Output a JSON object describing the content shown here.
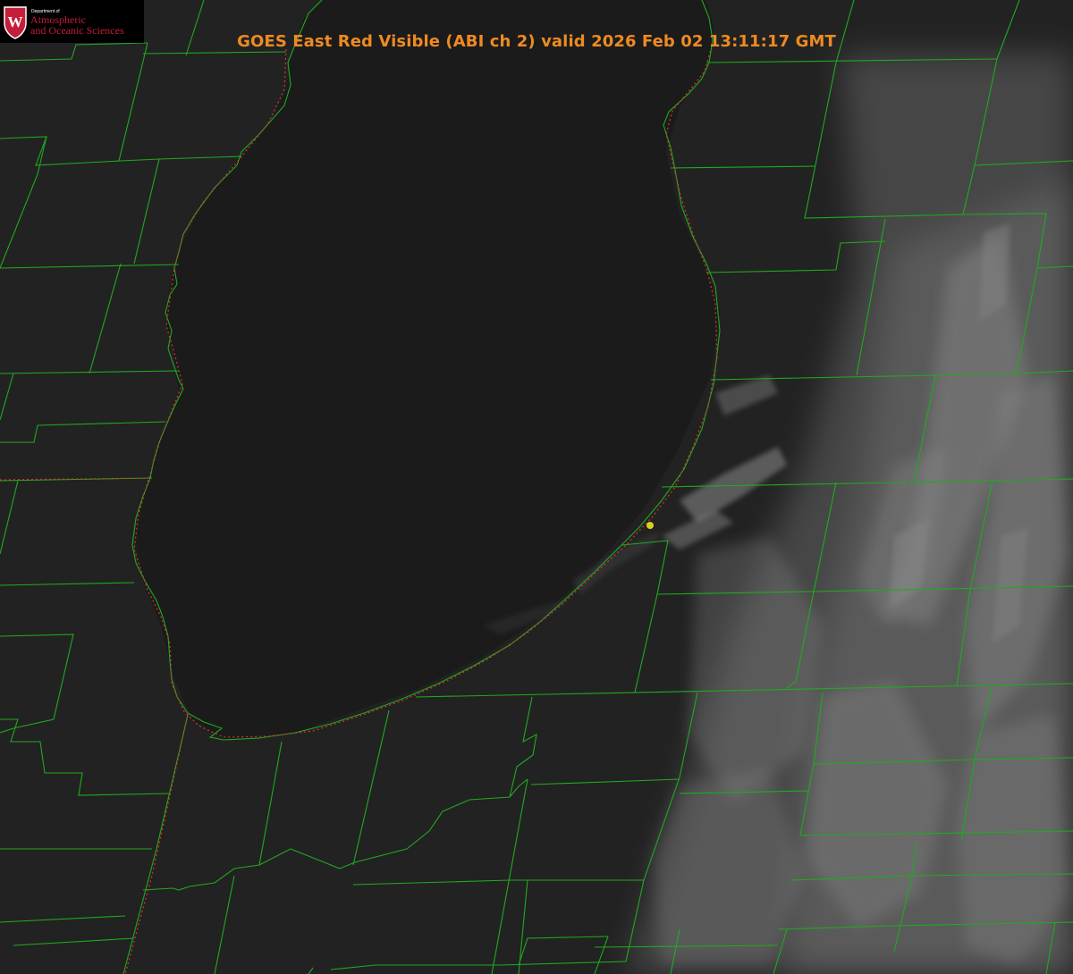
{
  "header": {
    "title": "GOES East Red Visible (ABI ch 2) valid 2026 Feb 02 13:11:17 GMT"
  },
  "logo": {
    "department": "Department of",
    "name_line1": "Atmospheric",
    "name_line2": "and Oceanic Sciences",
    "seal_letter": "W",
    "seal_color": "#c41e3a"
  },
  "map": {
    "background_color": "#222222",
    "lake_color": "#1b1b1b",
    "county_border_color": "#1faa1f",
    "state_border_color": "#e03030",
    "marker_color": "#d8d020",
    "cloud_color": "#8a8a8a"
  }
}
